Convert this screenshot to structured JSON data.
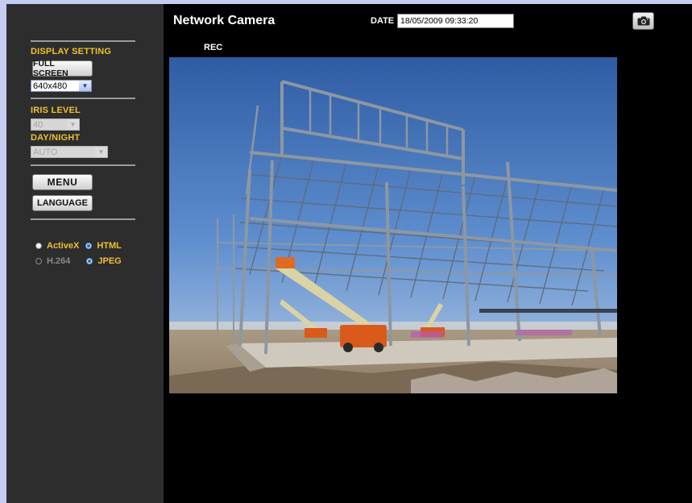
{
  "sidebar": {
    "display_setting_label": "DISPLAY SETTING",
    "full_screen_label": "FULL SCREEN",
    "resolution": {
      "value": "640x480"
    },
    "iris_label": "IRIS LEVEL",
    "iris": {
      "value": "40"
    },
    "daynight_label": "DAY/NIGHT",
    "daynight": {
      "value": "AUTO"
    },
    "menu_label": "MENU",
    "language_label": "LANGUAGE",
    "viewer": {
      "activex": "ActiveX",
      "html": "HTML",
      "h264": "H.264",
      "jpeg": "JPEG",
      "selected_mode": "HTML",
      "selected_codec": "JPEG"
    }
  },
  "header": {
    "title": "Network Camera",
    "date_label": "DATE",
    "date_value": "18/05/2009 09:33:20"
  },
  "video": {
    "rec_label": "REC"
  },
  "icons": {
    "snapshot": "camera-icon",
    "dropdown": "chevron-down-icon"
  },
  "colors": {
    "accent_label": "#f0c030",
    "sidebar_bg": "#2d2d2d",
    "main_bg": "#000000",
    "page_bg": "#c5cdf2"
  }
}
